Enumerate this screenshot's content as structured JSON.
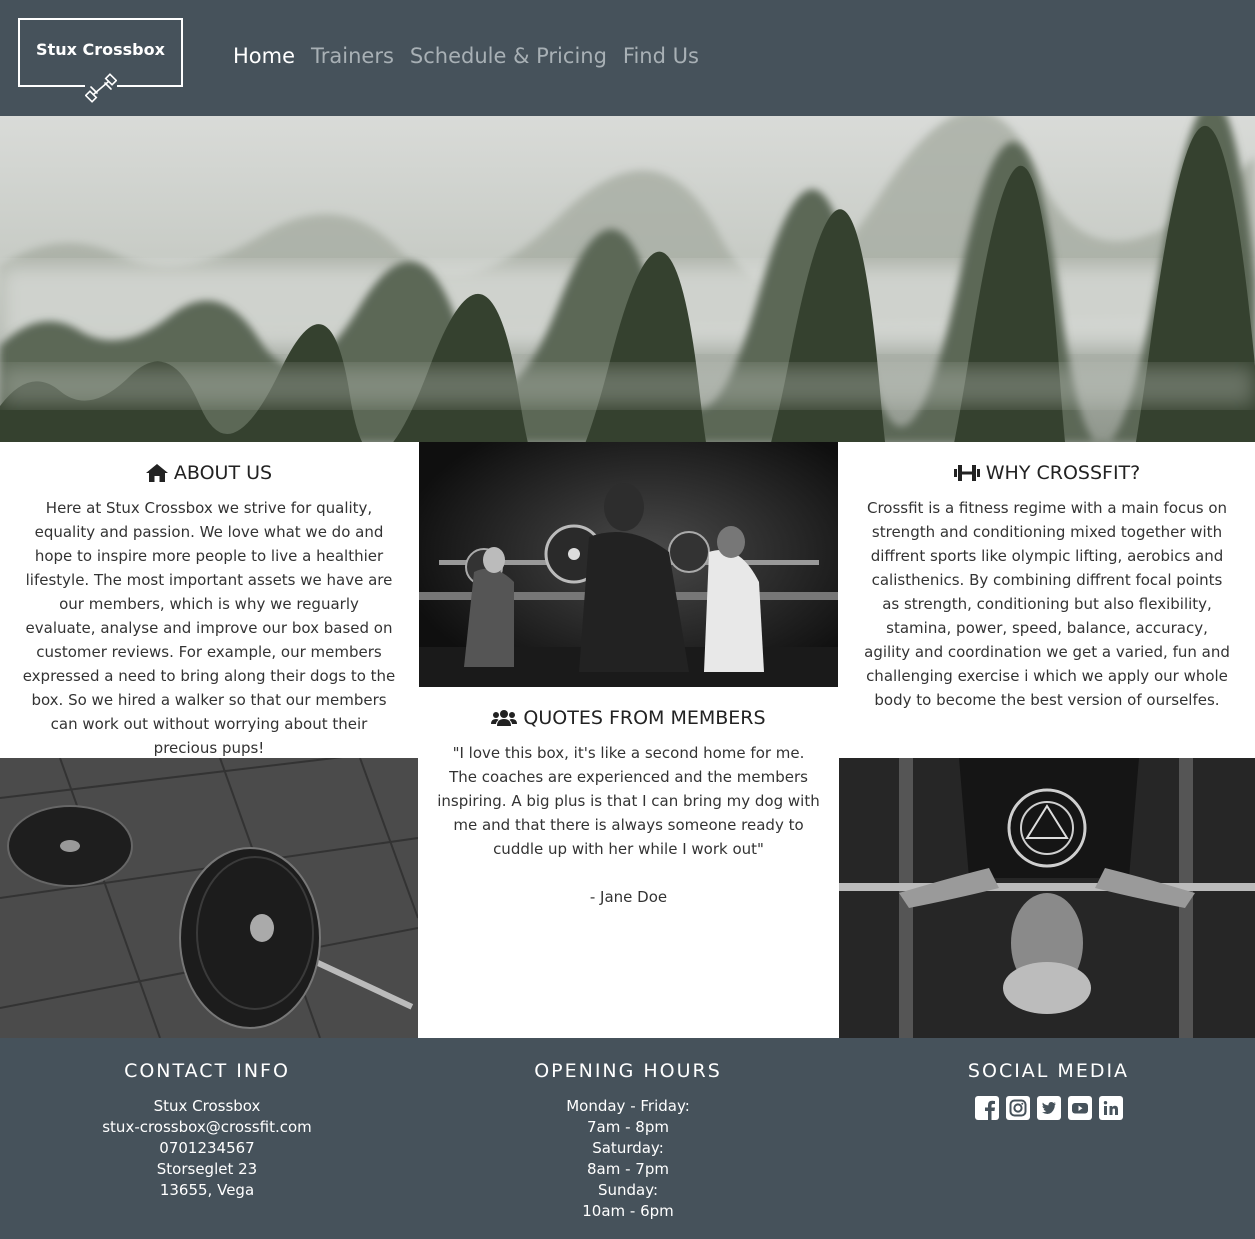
{
  "header": {
    "logo_text": "Stux Crossbox",
    "logo_icon": "dumbbell-icon",
    "nav": [
      {
        "label": "Home",
        "active": true
      },
      {
        "label": "Trainers",
        "active": false
      },
      {
        "label": "Schedule & Pricing",
        "active": false
      },
      {
        "label": "Find Us",
        "active": false
      }
    ]
  },
  "about": {
    "icon": "home-icon",
    "title": "ABOUT US",
    "body": "Here at Stux Crossbox we strive for quality, equality and passion. We love what we do and hope to inspire more people to live a healthier lifestyle. The most important assets we have are our members, which is why we reguarly evaluate, analyse and improve our box based on customer reviews. For example, our members expressed a need to bring along their dogs to the box. So we hired a walker so that our members can work out without worrying about their precious pups!"
  },
  "why": {
    "icon": "dumbbell-icon",
    "title": "WHY CROSSFIT?",
    "body": "Crossfit is a fitness regime with a main focus on strength and conditioning mixed together with diffrent sports like olympic lifting, aerobics and calisthenics. By combining diffrent focal points as strength, conditioning but also flexibility, stamina, power, speed, balance, accuracy, agility and coordination we get a varied, fun and challenging exercise i which we apply our whole body to become the best version of ourselfes."
  },
  "quotes": {
    "icon": "users-icon",
    "title": "QUOTES FROM MEMBERS",
    "quote": "\"I love this box, it's like a second home for me. The coaches are experienced and the members inspiring. A big plus is that I can bring my dog with me and that there is always someone ready to cuddle up with her while I work out\"",
    "author": "- Jane Doe"
  },
  "footer": {
    "contact": {
      "title": "CONTACT INFO",
      "lines": [
        "Stux Crossbox",
        "stux-crossbox@crossfit.com",
        "0701234567",
        "Storseglet 23",
        "13655, Vega"
      ]
    },
    "hours": {
      "title": "OPENING HOURS",
      "lines": [
        "Monday - Friday:",
        "7am - 8pm",
        "Saturday:",
        "8am - 7pm",
        "Sunday:",
        "10am - 6pm"
      ]
    },
    "social": {
      "title": "SOCIAL MEDIA",
      "icons": [
        "facebook-icon",
        "instagram-icon",
        "twitter-icon",
        "youtube-icon",
        "linkedin-icon"
      ]
    }
  },
  "colors": {
    "header_bg": "#46525b",
    "nav_active": "#ffffff",
    "nav_inactive": "#a8b0b5",
    "footer_bg": "#46525b"
  }
}
